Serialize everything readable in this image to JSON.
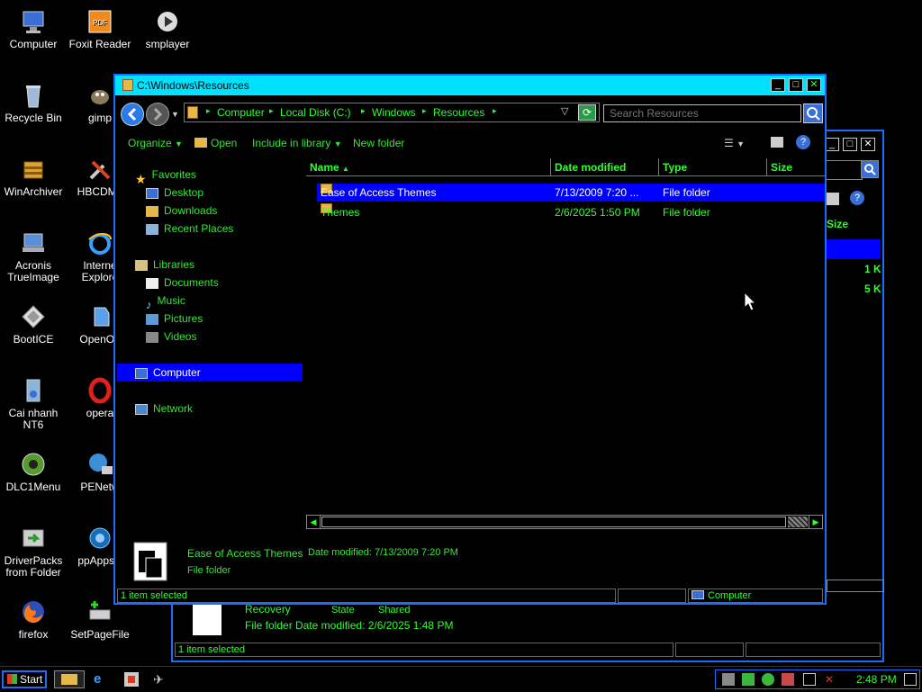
{
  "desktop": {
    "icons": [
      {
        "label": "Computer",
        "icon": "computer-icon"
      },
      {
        "label": "Foxit Reader",
        "icon": "pdf-icon"
      },
      {
        "label": "smplayer",
        "icon": "smplayer-icon"
      },
      {
        "label": "Recycle Bin",
        "icon": "recycle-bin-icon"
      },
      {
        "label": "gimp",
        "icon": "gimp-icon"
      },
      {
        "label": "WinArchiver",
        "icon": "archive-icon"
      },
      {
        "label": "HBCDMe",
        "icon": "tools-icon"
      },
      {
        "label": "Acronis TrueImage",
        "icon": "acronis-icon"
      },
      {
        "label": "Interne Explore",
        "icon": "ie-icon"
      },
      {
        "label": "BootICE",
        "icon": "bootice-icon"
      },
      {
        "label": "OpenOff",
        "icon": "openoffice-icon"
      },
      {
        "label": "Cai nhanh NT6",
        "icon": "installer-icon"
      },
      {
        "label": "opera",
        "icon": "opera-icon"
      },
      {
        "label": "DLC1Menu",
        "icon": "dlc-icon"
      },
      {
        "label": "PENetw",
        "icon": "network-globe-icon"
      },
      {
        "label": "DriverPacks from Folder",
        "icon": "driverpacks-icon"
      },
      {
        "label": "ppAppsC",
        "icon": "ppapps-icon"
      },
      {
        "label": "firefox",
        "icon": "firefox-icon"
      },
      {
        "label": "SetPageFile",
        "icon": "setpagefile-icon"
      }
    ]
  },
  "back_window": {
    "column_size": "Size",
    "size_1": "1 K",
    "size_2": "5 K",
    "details_name": "Recovery",
    "details_state_label": "State",
    "details_state_value": "Shared",
    "details_type": "File folder",
    "details_modified": "Date modified: 2/6/2025 1:48 PM",
    "status": "1 item selected"
  },
  "window": {
    "title": "C:\\Windows\\Resources",
    "breadcrumb": [
      "Computer",
      "Local Disk (C:)",
      "Windows",
      "Resources"
    ],
    "search_placeholder": "Search Resources",
    "toolbar": {
      "organize": "Organize",
      "open": "Open",
      "include": "Include in library",
      "new_folder": "New folder"
    },
    "nav": {
      "favorites": "Favorites",
      "desktop": "Desktop",
      "downloads": "Downloads",
      "recent": "Recent Places",
      "libraries": "Libraries",
      "documents": "Documents",
      "music": "Music",
      "pictures": "Pictures",
      "videos": "Videos",
      "computer": "Computer",
      "network": "Network"
    },
    "columns": {
      "name": "Name",
      "date": "Date modified",
      "type": "Type",
      "size": "Size"
    },
    "files": [
      {
        "name": "Ease of Access Themes",
        "date": "7/13/2009 7:20 ...",
        "type": "File folder",
        "size": ""
      },
      {
        "name": "Themes",
        "date": "2/6/2025 1:50 PM",
        "type": "File folder",
        "size": ""
      }
    ],
    "details": {
      "name": "Ease of Access Themes",
      "modified": "Date modified: 7/13/2009 7:20 PM",
      "type": "File folder"
    },
    "status": {
      "selected": "1 item selected",
      "location": "Computer"
    }
  },
  "taskbar": {
    "start": "Start",
    "clock": "2:48 PM"
  },
  "colors": {
    "titlebar": "#00e0ff",
    "selection": "#0000ff",
    "text": "#2dff2d",
    "border": "#1e6bff"
  }
}
